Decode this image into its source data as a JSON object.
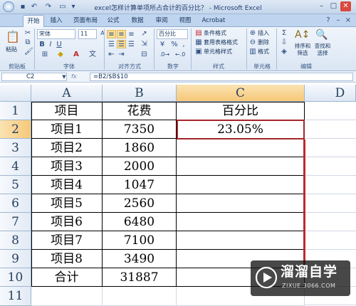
{
  "window": {
    "title": "excel怎样计算单项所占合计的百分比？ - Microsoft Excel",
    "min": "–",
    "max": "□",
    "close": "✕"
  },
  "tabs": [
    "开始",
    "插入",
    "页面布局",
    "公式",
    "数据",
    "审阅",
    "视图",
    "Acrobat"
  ],
  "ribbon": {
    "paste_label": "粘贴",
    "font_name": "宋体",
    "font_size": "11",
    "number_format": "百分比",
    "num_percent": "%",
    "num_comma": ",",
    "cond_format": "条件格式",
    "table_format": "套用表格格式",
    "cell_style": "单元格样式",
    "insert": "插入",
    "delete": "删除",
    "format": "格式",
    "sort_filter": "排序和\n筛选",
    "find_select": "查找和\n选择",
    "groups": [
      "剪贴板",
      "字体",
      "对齐方式",
      "数字",
      "样式",
      "单元格",
      "编辑"
    ]
  },
  "formula_bar": {
    "name_box": "C2",
    "fx": "fx",
    "formula": "=B2/$B$10"
  },
  "columns": [
    "A",
    "B",
    "C",
    "D"
  ],
  "rows": [
    "1",
    "2",
    "3",
    "4",
    "5",
    "6",
    "7",
    "8",
    "9",
    "10",
    "11"
  ],
  "table": {
    "headers": [
      "项目",
      "花费",
      "百分比"
    ],
    "data": [
      [
        "项目1",
        "7350",
        "23.05%"
      ],
      [
        "项目2",
        "1860",
        ""
      ],
      [
        "项目3",
        "2000",
        ""
      ],
      [
        "项目4",
        "1047",
        ""
      ],
      [
        "项目5",
        "2560",
        ""
      ],
      [
        "项目6",
        "6480",
        ""
      ],
      [
        "项目7",
        "7100",
        ""
      ],
      [
        "项目8",
        "3490",
        ""
      ],
      [
        "合计",
        "31887",
        ""
      ]
    ]
  },
  "watermark": {
    "brand": "溜溜自学",
    "url": "ZIXUE.3066.COM"
  },
  "colors": {
    "accent_red": "#c0282c",
    "selection_header": "#f6c878"
  }
}
